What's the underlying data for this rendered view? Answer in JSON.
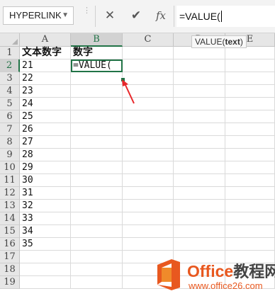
{
  "formula_bar": {
    "name_box": "HYPERLINK",
    "cancel_symbol": "✕",
    "enter_symbol": "✔",
    "fx_symbol": "fx",
    "formula": "=VALUE("
  },
  "tooltip": {
    "func": "VALUE(",
    "arg": "text",
    "close": ")"
  },
  "columns": [
    "A",
    "B",
    "C",
    "D",
    "E"
  ],
  "rows": [
    "1",
    "2",
    "3",
    "4",
    "5",
    "6",
    "7",
    "8",
    "9",
    "10",
    "11",
    "12",
    "13",
    "14",
    "15",
    "16",
    "17",
    "18",
    "19"
  ],
  "cells": {
    "A1": "文本数字",
    "B1": "数字",
    "B2": "=VALUE(",
    "A": [
      "21",
      "22",
      "23",
      "24",
      "25",
      "26",
      "27",
      "28",
      "29",
      "30",
      "31",
      "32",
      "33",
      "34",
      "35"
    ]
  },
  "watermark": {
    "brand": "Office",
    "brand_cn": "教程网",
    "url": "www.office26.com"
  },
  "colors": {
    "accent": "#217346",
    "arrow": "#e8282b",
    "watermark": "#e8581f"
  }
}
